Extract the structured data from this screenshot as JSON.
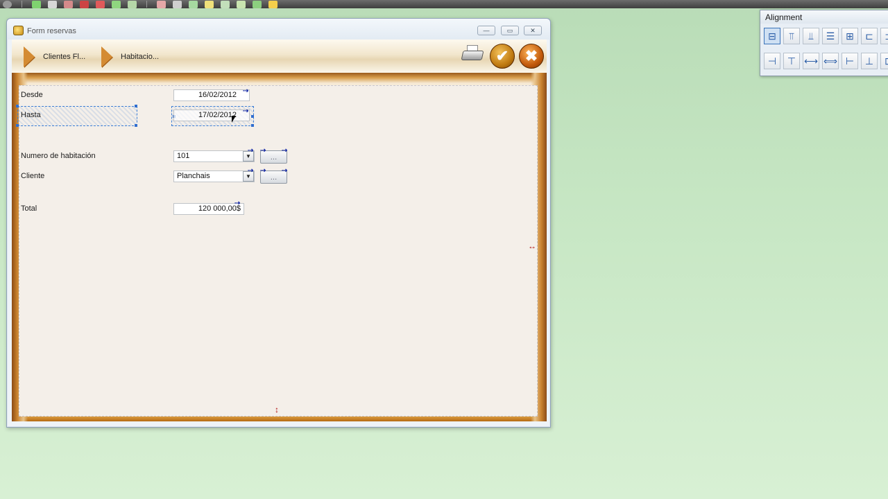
{
  "window": {
    "title": "Form reservas",
    "min_glyph": "—",
    "max_glyph": "▭",
    "close_glyph": "✕"
  },
  "breadcrumbs": [
    "Clientes Fl...",
    "Habitacio..."
  ],
  "header_icons": [
    "printer-icon",
    "check-icon",
    "cancel-icon"
  ],
  "header_glyphs": {
    "check": "✔",
    "cancel": "✖"
  },
  "form": {
    "desde_label": "Desde",
    "desde_value": "16/02/2012",
    "hasta_label": "Hasta",
    "hasta_value": "17/02/2012",
    "habitacion_label": "Numero de habitación",
    "habitacion_value": "101",
    "cliente_label": "Cliente",
    "cliente_value": "Planchais",
    "total_label": "Total",
    "total_value": "120 000,00$"
  },
  "glyphs": {
    "bind_arrow": "⇢",
    "dropdown": "▼",
    "lookup": "…",
    "resize_right": "↔",
    "resize_down": "↕"
  },
  "palette": {
    "title": "Alignment",
    "buttons": [
      "⊟",
      "⫪",
      "⫫",
      "☰",
      "⊞",
      "⊏",
      "⊐",
      "⊣",
      "⊤",
      "⟷",
      "⟺",
      "⊢",
      "⊥",
      "⊡"
    ]
  },
  "colors": {
    "accent_wood": "#c9822e",
    "selection": "#3d7fd6",
    "bind_arrow": "#1a2ea8",
    "resize_mark": "#b01515"
  }
}
